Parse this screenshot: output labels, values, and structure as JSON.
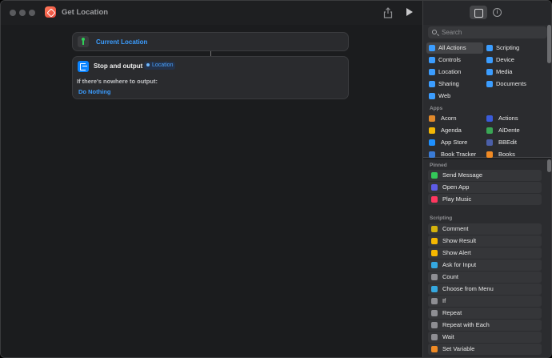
{
  "window": {
    "title": "Get Location"
  },
  "editor": {
    "action1": {
      "label": "Current Location"
    },
    "action2": {
      "title": "Stop and output",
      "variable": "Location",
      "question": "If there's nowhere to output:",
      "link": "Do Nothing"
    }
  },
  "sidebar": {
    "search_placeholder": "Search",
    "categories": [
      {
        "label": "All Actions",
        "color": "#3b9dff",
        "icon": "list-icon"
      },
      {
        "label": "Scripting",
        "color": "#3b9dff",
        "icon": "scripting-icon"
      },
      {
        "label": "Controls",
        "color": "#3b9dff",
        "icon": "controls-icon"
      },
      {
        "label": "Device",
        "color": "#3b9dff",
        "icon": "device-icon"
      },
      {
        "label": "Location",
        "color": "#3b9dff",
        "icon": "location-arrow-icon"
      },
      {
        "label": "Media",
        "color": "#3b9dff",
        "icon": "music-note-icon"
      },
      {
        "label": "Sharing",
        "color": "#3b9dff",
        "icon": "share-icon"
      },
      {
        "label": "Documents",
        "color": "#3b9dff",
        "icon": "document-icon"
      },
      {
        "label": "Web",
        "color": "#3b9dff",
        "icon": "compass-icon"
      }
    ],
    "apps_label": "Apps",
    "apps": [
      {
        "label": "Acorn",
        "color": "#e0892b"
      },
      {
        "label": "Actions",
        "color": "#3a5bd9"
      },
      {
        "label": "Agenda",
        "color": "#f2b705"
      },
      {
        "label": "AlDente",
        "color": "#3aa655"
      },
      {
        "label": "App Store",
        "color": "#1e90ff"
      },
      {
        "label": "BBEdit",
        "color": "#4b5fa8"
      },
      {
        "label": "Book Tracker",
        "color": "#3a7bd5"
      },
      {
        "label": "Books",
        "color": "#f08a24"
      }
    ],
    "pinned_label": "Pinned",
    "pinned": [
      {
        "label": "Send Message",
        "color": "#34c759"
      },
      {
        "label": "Open App",
        "color": "#5e5ce6"
      },
      {
        "label": "Play Music",
        "color": "#ff375f"
      }
    ],
    "scripting_label": "Scripting",
    "scripting": [
      {
        "label": "Comment",
        "color": "#d4b20c"
      },
      {
        "label": "Show Result",
        "color": "#f5b700"
      },
      {
        "label": "Show Alert",
        "color": "#f5b700"
      },
      {
        "label": "Ask for Input",
        "color": "#35a8e0"
      },
      {
        "label": "Count",
        "color": "#8e8e93"
      },
      {
        "label": "Choose from Menu",
        "color": "#35a8e0"
      },
      {
        "label": "If",
        "color": "#8e8e93"
      },
      {
        "label": "Repeat",
        "color": "#8e8e93"
      },
      {
        "label": "Repeat with Each",
        "color": "#8e8e93"
      },
      {
        "label": "Wait",
        "color": "#8e8e93"
      },
      {
        "label": "Set Variable",
        "color": "#f08a24"
      }
    ]
  }
}
